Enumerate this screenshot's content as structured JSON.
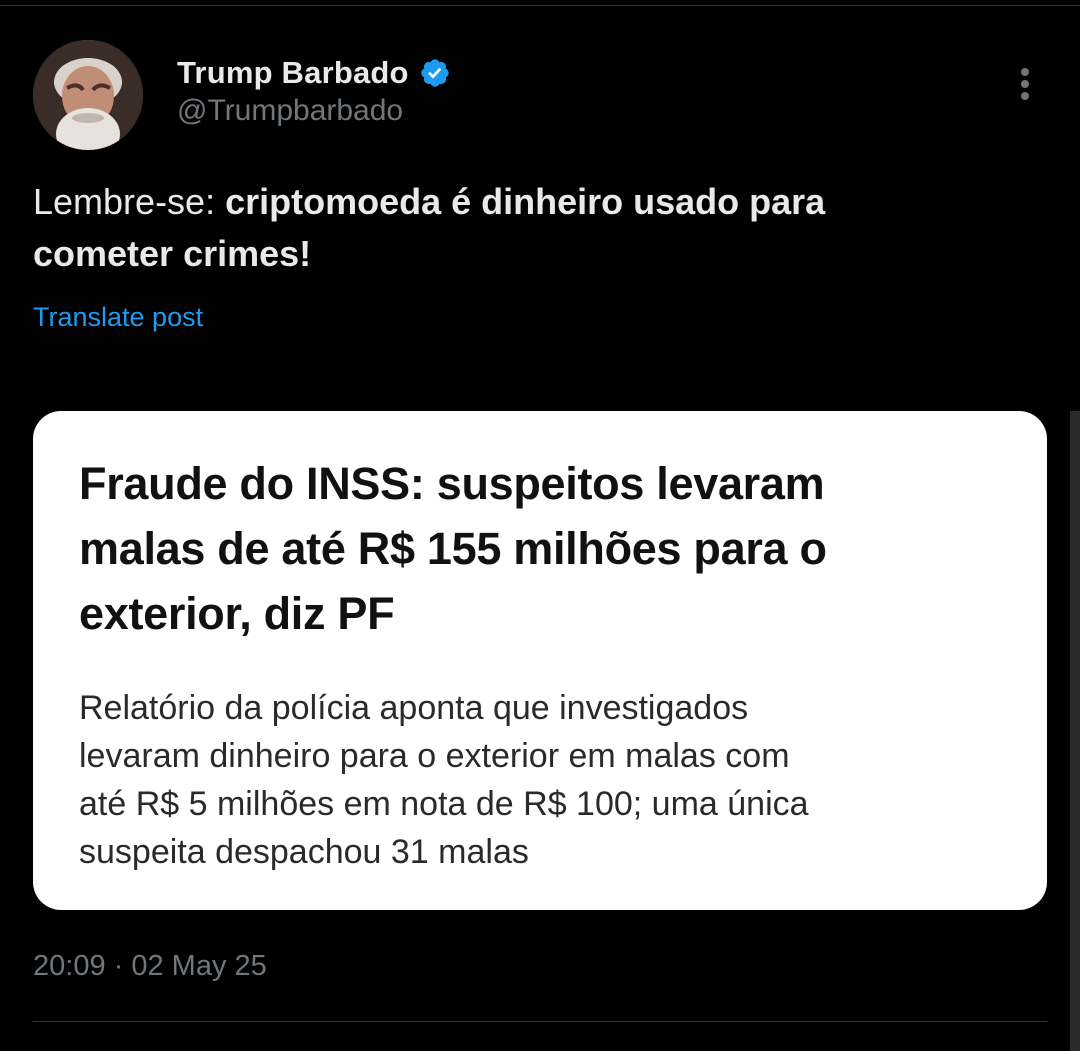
{
  "author": {
    "display_name": "Trump Barbado",
    "handle": "@Trumpbarbado",
    "verified_color": "#1d9bf0"
  },
  "post": {
    "text_lead": "Lembre-se: ",
    "text_bold_1": "criptomoeda é dinheiro usado para",
    "text_bold_2": "cometer crimes!",
    "translate_label": "Translate post"
  },
  "media": {
    "headline_1": "Fraude do INSS: suspeitos levaram",
    "headline_2": "malas de até R$ 155 milhões para o",
    "headline_3": "exterior, diz PF",
    "summary_1": "Relatório da polícia aponta que investigados",
    "summary_2": "levaram dinheiro para o exterior em malas com",
    "summary_3": "até R$ 5 milhões em nota de R$ 100; uma única",
    "summary_4": "suspeita despachou 31 malas"
  },
  "meta": {
    "timestamp": "20:09 · 02 May 25"
  },
  "icons": {
    "verified": "verified-badge-icon",
    "more": "more-vertical-icon"
  },
  "colors": {
    "background": "#000000",
    "text": "#e7e9ea",
    "muted": "#71767b",
    "link": "#1d9bf0"
  }
}
